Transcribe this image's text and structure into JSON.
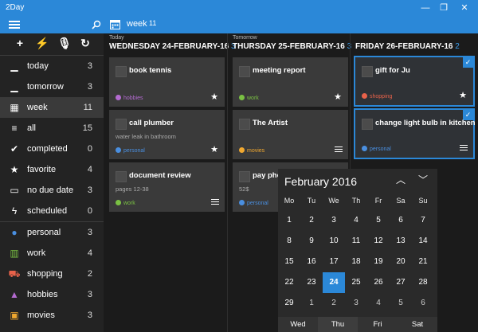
{
  "app": {
    "title": "2Day"
  },
  "window": {
    "minimize": "—",
    "maximize": "❐",
    "close": "✕"
  },
  "header": {
    "view_title": "week",
    "view_count": "11"
  },
  "toolbar": [
    {
      "icon": "plus-icon",
      "glyph": "+"
    },
    {
      "icon": "quick-add-icon",
      "glyph": "⚡"
    },
    {
      "icon": "microphone-icon",
      "glyph": "🎙"
    },
    {
      "icon": "sync-icon",
      "glyph": "↻"
    }
  ],
  "sidebar": {
    "items": [
      {
        "label": "today",
        "count": "3",
        "icon": "today-icon",
        "glyph": "▁"
      },
      {
        "label": "tomorrow",
        "count": "3",
        "icon": "tomorrow-icon",
        "glyph": "▁"
      },
      {
        "label": "week",
        "count": "11",
        "icon": "calendar-week-icon",
        "glyph": "▦"
      },
      {
        "label": "all",
        "count": "15",
        "icon": "list-icon",
        "glyph": "≡"
      },
      {
        "label": "completed",
        "count": "0",
        "icon": "checkmark-icon",
        "glyph": "✔"
      },
      {
        "label": "favorite",
        "count": "4",
        "icon": "star-icon",
        "glyph": "★"
      },
      {
        "label": "no due date",
        "count": "3",
        "icon": "calendar-icon",
        "glyph": "▭"
      },
      {
        "label": "scheduled",
        "count": "0",
        "icon": "bolt-icon",
        "glyph": "ϟ"
      },
      {
        "label": "personal",
        "count": "3",
        "icon": "person-icon",
        "glyph": "●"
      },
      {
        "label": "work",
        "count": "4",
        "icon": "building-icon",
        "glyph": "▥"
      },
      {
        "label": "shopping",
        "count": "2",
        "icon": "cart-icon",
        "glyph": "⛟"
      },
      {
        "label": "hobbies",
        "count": "3",
        "icon": "image-icon",
        "glyph": "▲"
      },
      {
        "label": "movies",
        "count": "3",
        "icon": "film-icon",
        "glyph": "▣"
      }
    ]
  },
  "columns": [
    {
      "small": "Today",
      "heading": "WEDNESDAY 24-FEBRUARY-16",
      "count": "3",
      "cards": [
        {
          "title": "book tennis",
          "note": "",
          "tag": "hobbies",
          "tag_color": "#b46bd1",
          "marker": "star"
        },
        {
          "title": "call plumber",
          "note": "water leak in bathroom",
          "tag": "personal",
          "tag_color": "#4a8fe0",
          "marker": "star"
        },
        {
          "title": "document review",
          "note": "pages 12-38",
          "tag": "work",
          "tag_color": "#7ac143",
          "marker": "lines"
        }
      ]
    },
    {
      "small": "Tomorrow",
      "heading": "THURSDAY 25-FEBRUARY-16",
      "count": "3",
      "cards": [
        {
          "title": "meeting report",
          "note": "",
          "tag": "work",
          "tag_color": "#7ac143",
          "marker": "star"
        },
        {
          "title": "The Artist",
          "note": "",
          "tag": "movies",
          "tag_color": "#f0a830",
          "marker": "lines"
        },
        {
          "title": "pay pho",
          "note": "52$",
          "tag": "personal",
          "tag_color": "#4a8fe0",
          "marker": "none"
        }
      ]
    },
    {
      "small": "",
      "heading": "FRIDAY 26-FEBRUARY-16",
      "count": "2",
      "cards": [
        {
          "title": "gift for Ju",
          "note": "",
          "tag": "shopping",
          "tag_color": "#e8624a",
          "marker": "star"
        },
        {
          "title": "change light bulb in kitchen",
          "note": "",
          "tag": "personal",
          "tag_color": "#4a8fe0",
          "marker": "lines"
        }
      ]
    }
  ],
  "calendar": {
    "title": "February 2016",
    "up": "︿",
    "down": "﹀",
    "weekdays": [
      "Mo",
      "Tu",
      "We",
      "Th",
      "Fr",
      "Sa",
      "Su"
    ],
    "weeks": [
      [
        "1",
        "2",
        "3",
        "4",
        "5",
        "6",
        "7"
      ],
      [
        "8",
        "9",
        "10",
        "11",
        "12",
        "13",
        "14"
      ],
      [
        "15",
        "16",
        "17",
        "18",
        "19",
        "20",
        "21"
      ],
      [
        "22",
        "23",
        "24",
        "25",
        "26",
        "27",
        "28"
      ],
      [
        "29",
        "1",
        "2",
        "3",
        "4",
        "5",
        "6"
      ]
    ],
    "selected": "24",
    "footer": [
      "Wed",
      "Thu",
      "Fri",
      "Sat"
    ]
  },
  "colors": {
    "accent": "#2b88d8",
    "card": "#3a3a3a",
    "background": "#1b1b1b"
  }
}
